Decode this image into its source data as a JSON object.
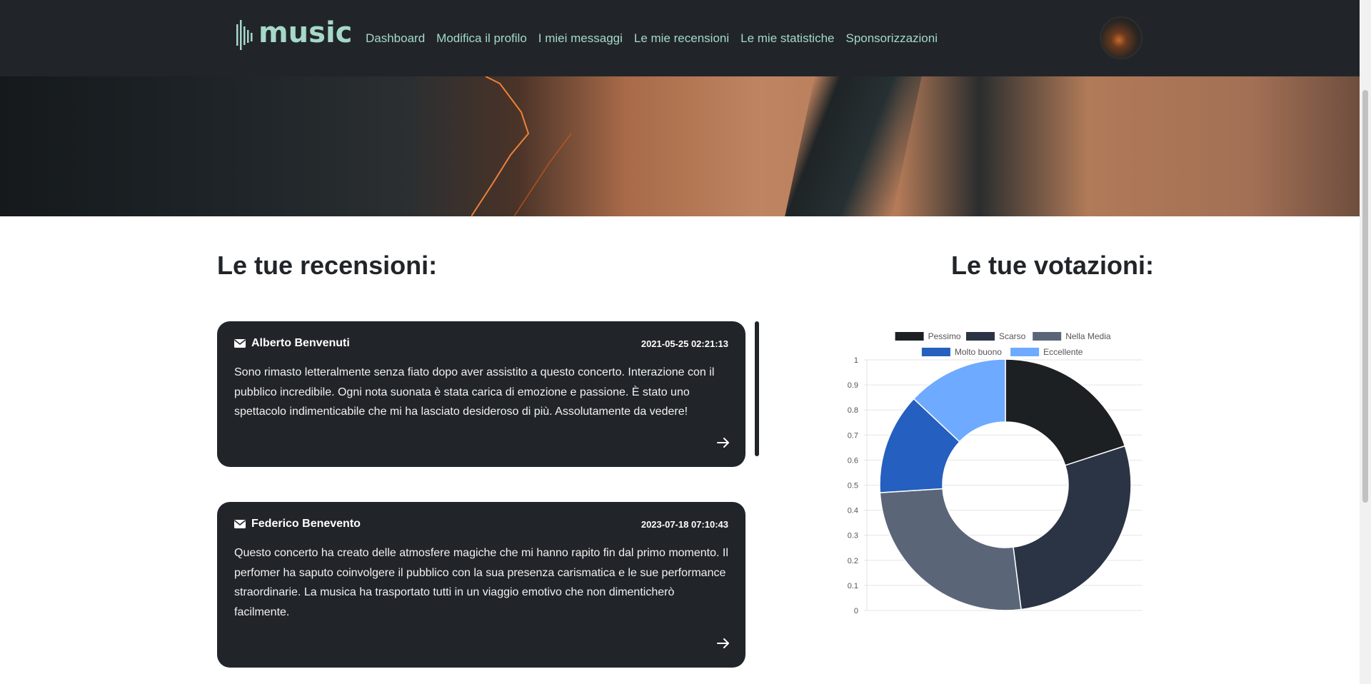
{
  "navbar": {
    "logo_text": "music",
    "links": [
      {
        "label": "Dashboard"
      },
      {
        "label": "Modifica il profilo"
      },
      {
        "label": "I miei messaggi"
      },
      {
        "label": "Le mie recensioni"
      },
      {
        "label": "Le mie statistiche"
      },
      {
        "label": "Sponsorizzazioni"
      }
    ],
    "accent_color": "#a6d8c8",
    "background_color": "#212529"
  },
  "reviews_section": {
    "title": "Le tue recensioni:",
    "items": [
      {
        "author": "Alberto Benvenuti",
        "date": "2021-05-25 02:21:13",
        "text": "Sono rimasto letteralmente senza fiato dopo aver assistito a questo concerto. Interazione con il pubblico incredibile. Ogni nota suonata è stata carica di emozione e passione. È stato uno spettacolo indimenticabile che mi ha lasciato desideroso di più. Assolutamente da vedere!"
      },
      {
        "author": "Federico Benevento",
        "date": "2023-07-18 07:10:43",
        "text": "Questo concerto ha creato delle atmosfere magiche che mi hanno rapito fin dal primo momento. Il perfomer ha saputo coinvolgere il pubblico con la sua presenza carismatica e le sue performance straordinarie. La musica ha trasportato tutti in un viaggio emotivo che non dimenticherò facilmente."
      }
    ],
    "icons": {
      "author": "envelope-icon",
      "open": "arrow-right-icon"
    }
  },
  "ratings_section": {
    "title": "Le tue votazioni:"
  },
  "chart_data": {
    "type": "doughnut",
    "categories": [
      "Pessimo",
      "Scarso",
      "Nella Media",
      "Molto buono",
      "Eccellente"
    ],
    "values": [
      20,
      28,
      26,
      13,
      13
    ],
    "colors": [
      "#1d2023",
      "#2a3444",
      "#5a6678",
      "#255fbf",
      "#6eaaff"
    ],
    "ylim": [
      0,
      1
    ],
    "yticks": [
      "1",
      "0.9",
      "0.8",
      "0.7",
      "0.6",
      "0.5",
      "0.4",
      "0.3",
      "0.2",
      "0.1",
      "0"
    ],
    "legend": "top",
    "grid": true
  }
}
